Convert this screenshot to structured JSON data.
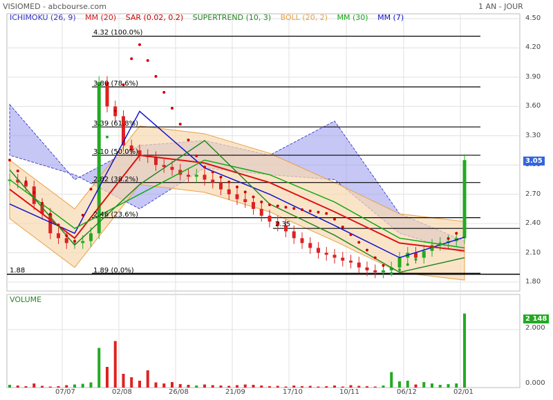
{
  "header": {
    "title": "VISIOMED - abcbourse.com",
    "period": "1 AN - JOUR"
  },
  "legend": [
    {
      "label": "ICHIMOKU (26, 9)",
      "color": "#3333cc"
    },
    {
      "label": "MM (20)",
      "color": "#dd1111"
    },
    {
      "label": "SAR (0.02, 0.2)",
      "color": "#cc0000"
    },
    {
      "label": "SUPERTREND (10, 3)",
      "color": "#228822"
    },
    {
      "label": "BOLL (20, 2)",
      "color": "#e8a040"
    },
    {
      "label": "MM (30)",
      "color": "#11aa11"
    },
    {
      "label": "MM (7)",
      "color": "#1111cc"
    }
  ],
  "price_axis": [
    "4.50",
    "4.20",
    "3.90",
    "3.60",
    "3.30",
    "3.00",
    "2.70",
    "2.40",
    "2.10",
    "1.80"
  ],
  "volume_axis": [
    "2.000",
    "0.000"
  ],
  "x_axis": [
    "07/07",
    "02/08",
    "26/08",
    "21/09",
    "17/10",
    "10/11",
    "06/12",
    "02/01"
  ],
  "last_price": "3.05",
  "last_volume": "2 148",
  "fibonacci": [
    {
      "price": 4.32,
      "label": "4.32 (100.0%)"
    },
    {
      "price": 3.8,
      "label": "3.80 (78.6%)"
    },
    {
      "price": 3.39,
      "label": "3.39 (61.8%)"
    },
    {
      "price": 3.1,
      "label": "3.10 (50.0%)"
    },
    {
      "price": 2.82,
      "label": "2.82 (38.2%)"
    },
    {
      "price": 2.46,
      "label": "2.46 (23.6%)"
    },
    {
      "price": 1.89,
      "label": "1.89 (0.0%)"
    }
  ],
  "horizontal_lines": [
    {
      "price": 2.35,
      "label": "2.35"
    },
    {
      "price": 1.88,
      "label": "1.88"
    }
  ],
  "volume_title": "VOLUME",
  "colors": {
    "up": "#22aa22",
    "down": "#dd2222",
    "ichimoku_cloud": "#9999ee",
    "boll_fill": "#f8d9b0",
    "grid": "#e0e0e0",
    "last_price_badge": "#3366dd",
    "last_volume_badge": "#22aa22"
  },
  "chart_data": {
    "type": "line",
    "title": "VISIOMED - abcbourse.com",
    "x": [
      "07/07",
      "02/08",
      "26/08",
      "21/09",
      "17/10",
      "10/11",
      "06/12",
      "02/01"
    ],
    "ylim": [
      1.75,
      4.55
    ],
    "grid": true,
    "series": [
      {
        "name": "MM (7)",
        "values": [
          2.6,
          2.3,
          3.55,
          2.97,
          2.7,
          2.38,
          2.05,
          2.26
        ]
      },
      {
        "name": "MM (20)",
        "values": [
          2.75,
          2.25,
          3.1,
          3.02,
          2.82,
          2.52,
          2.2,
          2.12
        ]
      },
      {
        "name": "MM (30)",
        "values": [
          2.85,
          2.35,
          2.7,
          3.05,
          2.9,
          2.62,
          2.25,
          2.15
        ]
      },
      {
        "name": "SUPERTREND (10, 3)",
        "values": [
          2.95,
          2.18,
          2.8,
          3.25,
          2.6,
          2.28,
          1.9,
          2.05
        ]
      },
      {
        "name": "SAR (0.02, 0.2)",
        "values": [
          3.05,
          2.18,
          4.28,
          3.0,
          2.6,
          2.5,
          1.88,
          2.3
        ]
      }
    ],
    "ichimoku_cloud": {
      "x": [
        "07/07",
        "02/08",
        "26/08",
        "21/09",
        "17/10",
        "10/11",
        "06/12",
        "02/01"
      ],
      "upper": [
        3.62,
        2.85,
        3.2,
        3.25,
        3.1,
        3.45,
        2.5,
        2.22
      ],
      "lower": [
        3.1,
        2.9,
        2.55,
        2.97,
        2.9,
        2.85,
        2.3,
        2.1
      ]
    },
    "closes": [
      2.85,
      2.82,
      2.78,
      2.6,
      2.5,
      2.3,
      2.25,
      2.2,
      2.2,
      2.22,
      2.3,
      3.85,
      3.6,
      3.5,
      3.2,
      3.15,
      3.1,
      3.08,
      3.0,
      2.98,
      2.95,
      2.9,
      2.88,
      2.9,
      2.85,
      2.82,
      2.75,
      2.7,
      2.65,
      2.62,
      2.55,
      2.48,
      2.42,
      2.38,
      2.32,
      2.25,
      2.2,
      2.15,
      2.1,
      2.08,
      2.05,
      2.02,
      2.0,
      1.95,
      1.92,
      1.9,
      1.92,
      1.95,
      2.05,
      2.1,
      2.05,
      2.12,
      2.18,
      2.2,
      2.22,
      2.25,
      3.05
    ],
    "volumes": [
      80,
      60,
      40,
      120,
      50,
      30,
      40,
      70,
      90,
      110,
      150,
      1150,
      600,
      1350,
      400,
      300,
      200,
      500,
      150,
      120,
      160,
      100,
      80,
      60,
      90,
      70,
      60,
      50,
      70,
      90,
      80,
      60,
      40,
      50,
      30,
      60,
      40,
      50,
      30,
      40,
      60,
      30,
      70,
      50,
      40,
      30,
      60,
      450,
      180,
      200,
      90,
      160,
      120,
      80,
      100,
      120,
      2148
    ]
  }
}
